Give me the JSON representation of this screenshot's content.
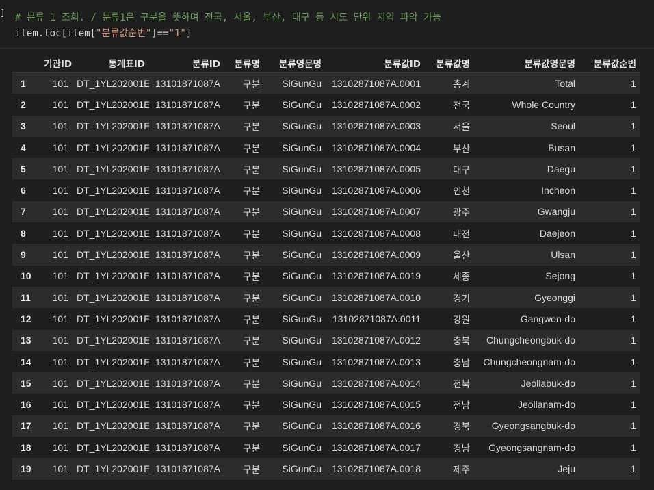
{
  "cell": {
    "bracket": "]",
    "comment": "# 분류 1 조회. / 분류1은 구분을 뜻하며 전국, 서울, 부산, 대구 등 시도 단위 지역 파악 가능",
    "code_prefix": "item.loc[item[",
    "code_key": "\"분류값순번\"",
    "code_mid": "]==",
    "code_val": "\"1\"",
    "code_suffix": "]"
  },
  "table": {
    "columns": [
      "",
      "기관ID",
      "통계표ID",
      "분류ID",
      "분류명",
      "분류영문명",
      "분류값ID",
      "분류값명",
      "분류값영문명",
      "분류값순번"
    ],
    "rows": [
      [
        "1",
        "101",
        "DT_1YL202001E",
        "13101871087A",
        "구분",
        "SiGunGu",
        "13102871087A.0001",
        "총계",
        "Total",
        "1"
      ],
      [
        "2",
        "101",
        "DT_1YL202001E",
        "13101871087A",
        "구분",
        "SiGunGu",
        "13102871087A.0002",
        "전국",
        "Whole Country",
        "1"
      ],
      [
        "3",
        "101",
        "DT_1YL202001E",
        "13101871087A",
        "구분",
        "SiGunGu",
        "13102871087A.0003",
        "서울",
        "Seoul",
        "1"
      ],
      [
        "4",
        "101",
        "DT_1YL202001E",
        "13101871087A",
        "구분",
        "SiGunGu",
        "13102871087A.0004",
        "부산",
        "Busan",
        "1"
      ],
      [
        "5",
        "101",
        "DT_1YL202001E",
        "13101871087A",
        "구분",
        "SiGunGu",
        "13102871087A.0005",
        "대구",
        "Daegu",
        "1"
      ],
      [
        "6",
        "101",
        "DT_1YL202001E",
        "13101871087A",
        "구분",
        "SiGunGu",
        "13102871087A.0006",
        "인천",
        "Incheon",
        "1"
      ],
      [
        "7",
        "101",
        "DT_1YL202001E",
        "13101871087A",
        "구분",
        "SiGunGu",
        "13102871087A.0007",
        "광주",
        "Gwangju",
        "1"
      ],
      [
        "8",
        "101",
        "DT_1YL202001E",
        "13101871087A",
        "구분",
        "SiGunGu",
        "13102871087A.0008",
        "대전",
        "Daejeon",
        "1"
      ],
      [
        "9",
        "101",
        "DT_1YL202001E",
        "13101871087A",
        "구분",
        "SiGunGu",
        "13102871087A.0009",
        "울산",
        "Ulsan",
        "1"
      ],
      [
        "10",
        "101",
        "DT_1YL202001E",
        "13101871087A",
        "구분",
        "SiGunGu",
        "13102871087A.0019",
        "세종",
        "Sejong",
        "1"
      ],
      [
        "11",
        "101",
        "DT_1YL202001E",
        "13101871087A",
        "구분",
        "SiGunGu",
        "13102871087A.0010",
        "경기",
        "Gyeonggi",
        "1"
      ],
      [
        "12",
        "101",
        "DT_1YL202001E",
        "13101871087A",
        "구분",
        "SiGunGu",
        "13102871087A.0011",
        "강원",
        "Gangwon-do",
        "1"
      ],
      [
        "13",
        "101",
        "DT_1YL202001E",
        "13101871087A",
        "구분",
        "SiGunGu",
        "13102871087A.0012",
        "충북",
        "Chungcheongbuk-do",
        "1"
      ],
      [
        "14",
        "101",
        "DT_1YL202001E",
        "13101871087A",
        "구분",
        "SiGunGu",
        "13102871087A.0013",
        "충남",
        "Chungcheongnam-do",
        "1"
      ],
      [
        "15",
        "101",
        "DT_1YL202001E",
        "13101871087A",
        "구분",
        "SiGunGu",
        "13102871087A.0014",
        "전북",
        "Jeollabuk-do",
        "1"
      ],
      [
        "16",
        "101",
        "DT_1YL202001E",
        "13101871087A",
        "구분",
        "SiGunGu",
        "13102871087A.0015",
        "전남",
        "Jeollanam-do",
        "1"
      ],
      [
        "17",
        "101",
        "DT_1YL202001E",
        "13101871087A",
        "구분",
        "SiGunGu",
        "13102871087A.0016",
        "경북",
        "Gyeongsangbuk-do",
        "1"
      ],
      [
        "18",
        "101",
        "DT_1YL202001E",
        "13101871087A",
        "구분",
        "SiGunGu",
        "13102871087A.0017",
        "경남",
        "Gyeongsangnam-do",
        "1"
      ],
      [
        "19",
        "101",
        "DT_1YL202001E",
        "13101871087A",
        "구분",
        "SiGunGu",
        "13102871087A.0018",
        "제주",
        "Jeju",
        "1"
      ]
    ]
  },
  "colors": {
    "background": "#1f1f1f",
    "row_alt": "#2c2c2c",
    "comment": "#6a9955",
    "string": "#ce9178"
  }
}
